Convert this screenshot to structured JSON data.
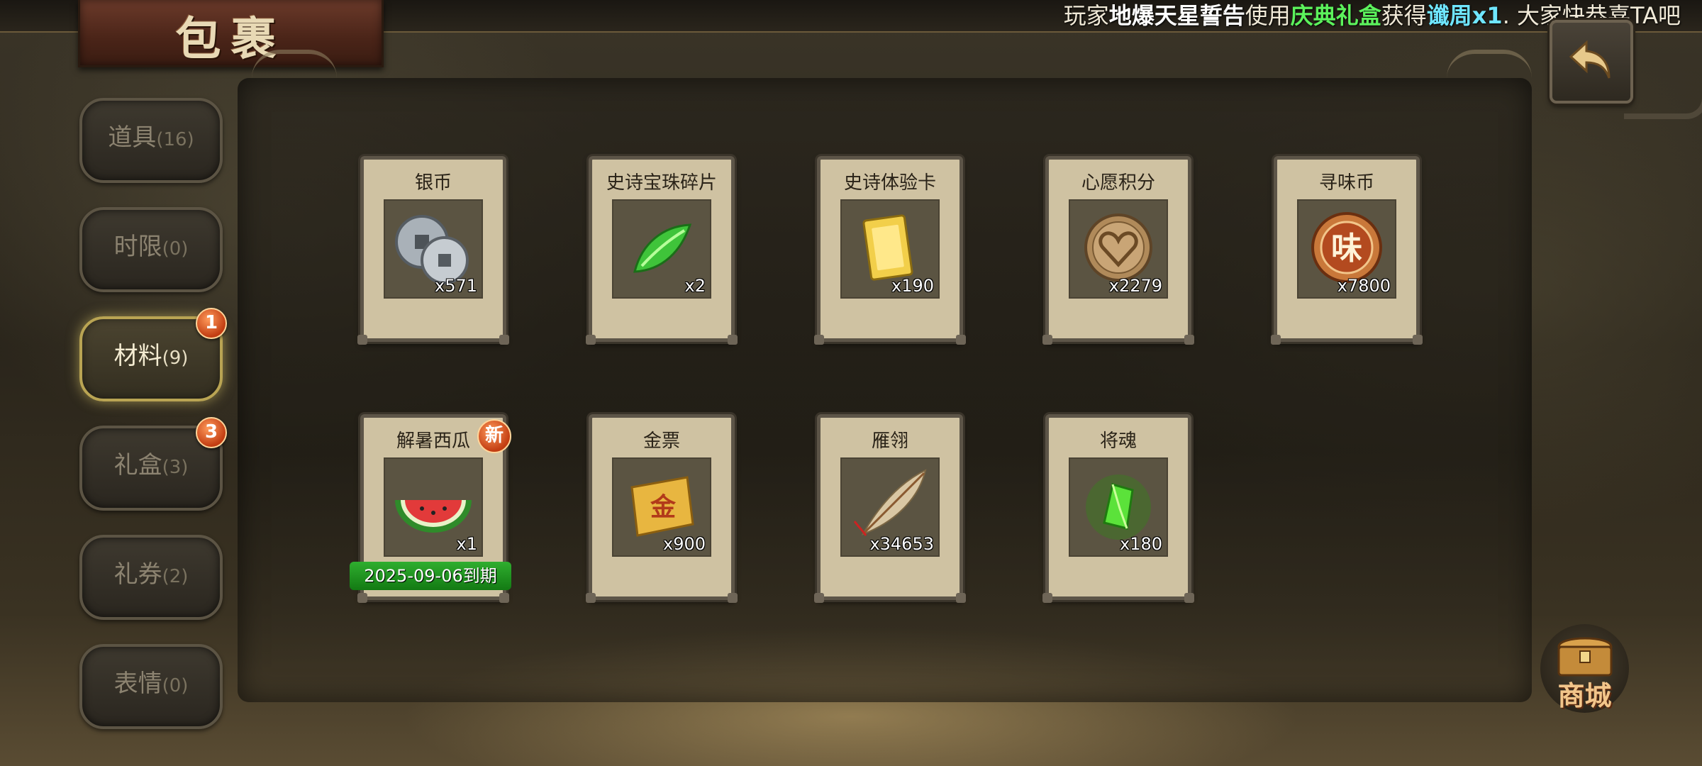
{
  "window": {
    "title": "包裹"
  },
  "announcement": {
    "prefix": "玩家",
    "player": "地爆天星誓告",
    "mid1": "使用",
    "item_used": "庆典礼盒",
    "mid2": "获得",
    "reward": "谶周x1",
    "suffix": ". 大家快恭喜TA吧"
  },
  "sidebar": {
    "tabs": [
      {
        "label": "道具",
        "count": "(16)",
        "active": false,
        "badge": ""
      },
      {
        "label": "时限",
        "count": "(0)",
        "active": false,
        "badge": ""
      },
      {
        "label": "材料",
        "count": "(9)",
        "active": true,
        "badge": "1"
      },
      {
        "label": "礼盒",
        "count": "(3)",
        "active": false,
        "badge": "3"
      },
      {
        "label": "礼券",
        "count": "(2)",
        "active": false,
        "badge": ""
      },
      {
        "label": "表情",
        "count": "(0)",
        "active": false,
        "badge": ""
      }
    ]
  },
  "items": [
    {
      "name": "银币",
      "qty": "x571",
      "icon": "silver-coin-icon"
    },
    {
      "name": "史诗宝珠碎片",
      "qty": "x2",
      "icon": "green-shard-icon"
    },
    {
      "name": "史诗体验卡",
      "qty": "x190",
      "icon": "gold-card-icon"
    },
    {
      "name": "心愿积分",
      "qty": "x2279",
      "icon": "heart-coin-icon"
    },
    {
      "name": "寻味币",
      "qty": "x7800",
      "icon": "flavor-coin-icon",
      "icon_text": "味"
    },
    {
      "name": "解暑西瓜",
      "qty": "x1",
      "icon": "watermelon-icon",
      "new_label": "新",
      "expire": "2025-09-06到期"
    },
    {
      "name": "金票",
      "qty": "x900",
      "icon": "gold-scroll-icon",
      "icon_text": "金"
    },
    {
      "name": "雁翎",
      "qty": "x34653",
      "icon": "feather-icon"
    },
    {
      "name": "将魂",
      "qty": "x180",
      "icon": "green-crystal-icon"
    }
  ],
  "shop": {
    "label": "商城"
  },
  "colors": {
    "accent_gold": "#b9a453",
    "badge_orange": "#c23d12",
    "expire_green": "#137a13",
    "announce_green": "#5cf25c",
    "announce_cyan": "#6fe6ff"
  }
}
